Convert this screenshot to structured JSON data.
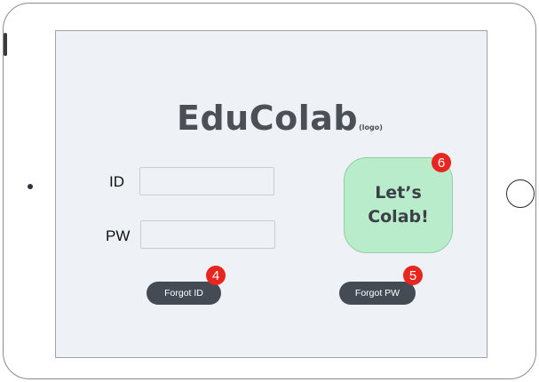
{
  "logo": {
    "name": "EduColab",
    "suffix": "(logo)"
  },
  "login": {
    "id_label": "ID",
    "id_value": "",
    "pw_label": "PW",
    "pw_value": ""
  },
  "buttons": {
    "forgot_id": "Forgot ID",
    "forgot_pw": "Forgot PW",
    "lets_colab_line1": "Let’s",
    "lets_colab_line2": "Colab!"
  },
  "annotations": {
    "forgot_id_badge": "4",
    "forgot_pw_badge": "5",
    "lets_colab_badge": "6"
  },
  "colors": {
    "screen_bg": "#eef1f6",
    "button_dark": "#454b55",
    "cta_green": "#b9eccb",
    "badge_red": "#e8261f"
  }
}
